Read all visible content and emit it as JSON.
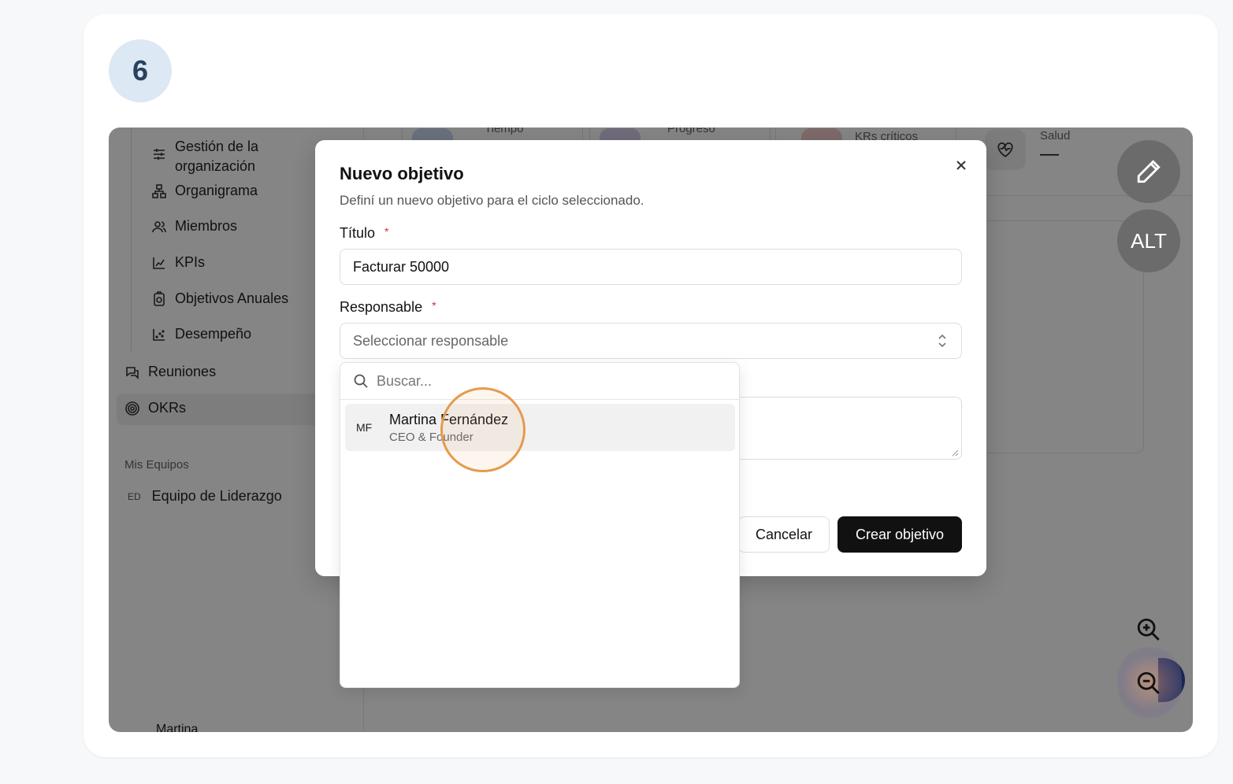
{
  "step": {
    "number": "6"
  },
  "app": {
    "sidebar": {
      "subnav": [
        {
          "label": "Gestión de la organización",
          "icon": "sliders-icon"
        },
        {
          "label": "Organigrama",
          "icon": "org-chart-icon"
        },
        {
          "label": "Miembros",
          "icon": "users-icon"
        },
        {
          "label": "KPIs",
          "icon": "chart-icon"
        },
        {
          "label": "Objetivos Anuales",
          "icon": "target-doc-icon"
        },
        {
          "label": "Desempeño",
          "icon": "scatter-icon"
        }
      ],
      "nav": [
        {
          "label": "Reuniones",
          "icon": "chat-icon"
        },
        {
          "label": "OKRs",
          "icon": "target-icon",
          "active": true
        }
      ],
      "section_title": "Mis Equipos",
      "team": {
        "abbr": "ED",
        "label": "Equipo de Liderazgo"
      },
      "bottom_user": "Martina"
    },
    "stats": [
      {
        "label": "Tiempo"
      },
      {
        "label": "Progreso"
      },
      {
        "label": "KRs críticos"
      },
      {
        "label": "Salud",
        "value": "—"
      }
    ]
  },
  "modal": {
    "title": "Nuevo objetivo",
    "description": "Definí un nuevo objetivo para el ciclo seleccionado.",
    "title_field": {
      "label": "Título",
      "required_mark": "*",
      "value": "Facturar 50000"
    },
    "owner_field": {
      "label": "Responsable",
      "required_mark": "*",
      "placeholder": "Seleccionar responsable"
    },
    "cancel_label": "Cancelar",
    "create_label": "Crear objetivo"
  },
  "dropdown": {
    "search_placeholder": "Buscar...",
    "options": [
      {
        "initials": "MF",
        "name": "Martina Fernández",
        "role": "CEO & Founder"
      }
    ]
  },
  "controls": {
    "alt_label": "ALT"
  },
  "colors": {
    "overlay": "#000000",
    "click_ring": "#e69a4c",
    "badge_bg": "#dce8f3",
    "badge_text": "#28425e",
    "primary_button": "#111111"
  }
}
